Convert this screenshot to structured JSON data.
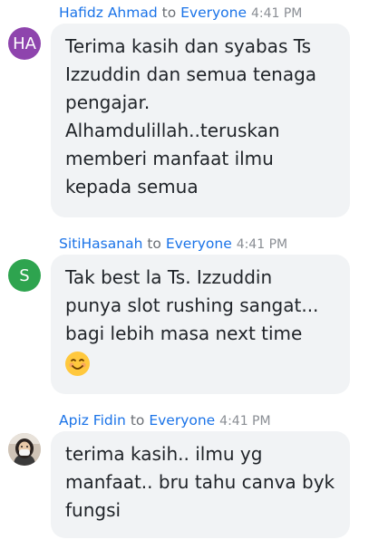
{
  "messages": [
    {
      "sender": "Hafidz Ahmad",
      "to_label": "to",
      "recipient": "Everyone",
      "time": "4:41 PM",
      "avatar": {
        "type": "initials",
        "initials": "HA",
        "color": "#8e44ad"
      },
      "text": "Terima kasih dan syabas Ts\nIzzuddin dan semua tenaga\npengajar.\nAlhamdulillah..teruskan\nmemberi manfaat ilmu\nkepada semua"
    },
    {
      "sender": "SitiHasanah",
      "to_label": "to",
      "recipient": "Everyone",
      "time": "4:41 PM",
      "avatar": {
        "type": "initials",
        "initials": "S",
        "color": "#2ea44f"
      },
      "text": "Tak best la Ts. Izzuddin\npunya slot rushing sangat...\nbagi lebih masa next time",
      "emoji": "smiling-face-emoji"
    },
    {
      "sender": "Apiz Fidin",
      "to_label": "to",
      "recipient": "Everyone",
      "time": "4:41 PM",
      "avatar": {
        "type": "photo"
      },
      "text": "terima kasih.. ilmu yg\nmanfaat.. bru tahu canva byk\nfungsi"
    }
  ]
}
